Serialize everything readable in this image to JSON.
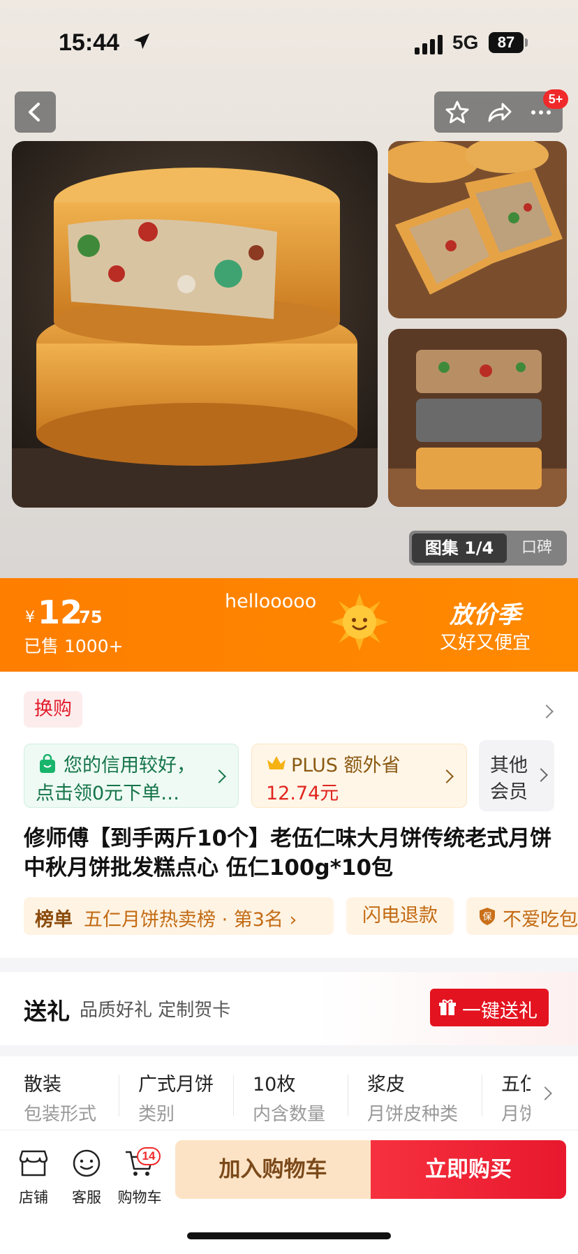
{
  "status": {
    "time": "15:44",
    "network": "5G",
    "battery": "87"
  },
  "header": {
    "message_badge": "5+"
  },
  "gallery": {
    "active_label": "图集 1/4",
    "other_label": "口碑"
  },
  "price": {
    "currency": "¥",
    "integer": "12",
    "decimal": ".75",
    "sold": "已售 1000+"
  },
  "promo": {
    "hello_text": "hellooooo",
    "title": "放价季",
    "subtitle": "又好又便宜"
  },
  "swap_tag": "换购",
  "credit": {
    "line1": "您的信用较好，",
    "line2": "点击领0元下单…"
  },
  "plus": {
    "line1": "PLUS 额外省",
    "line2": "12.74元"
  },
  "other_member": {
    "line1": "其他",
    "line2": "会员"
  },
  "product_title": "修师傅【到手两斤10个】老伍仁味大月饼传统老式月饼中秋月饼批发糕点心 伍仁100g*10包",
  "tags": {
    "rank_key": "榜单",
    "rank_value": "五仁月饼热卖榜 · 第3名 ›",
    "flash": "闪电退款",
    "guard_text": "不爱吃包"
  },
  "gift": {
    "title": "送礼",
    "subtitle": "品质好礼 定制贺卡",
    "button": "一键送礼"
  },
  "attributes": [
    {
      "value": "散装",
      "key": "包装形式"
    },
    {
      "value": "广式月饼",
      "key": "类别"
    },
    {
      "value": "10枚",
      "key": "内含数量"
    },
    {
      "value": "浆皮",
      "key": "月饼皮种类"
    },
    {
      "value": "五仁",
      "key": "月饼"
    }
  ],
  "bottom": {
    "store": "店铺",
    "service": "客服",
    "cart": "购物车",
    "cart_count": "14",
    "add_cart": "加入购物车",
    "buy_now": "立即购买"
  },
  "colors": {
    "accent_orange": "#fe7e00",
    "buy_red": "#e8182d",
    "price_red": "#e0251f"
  }
}
